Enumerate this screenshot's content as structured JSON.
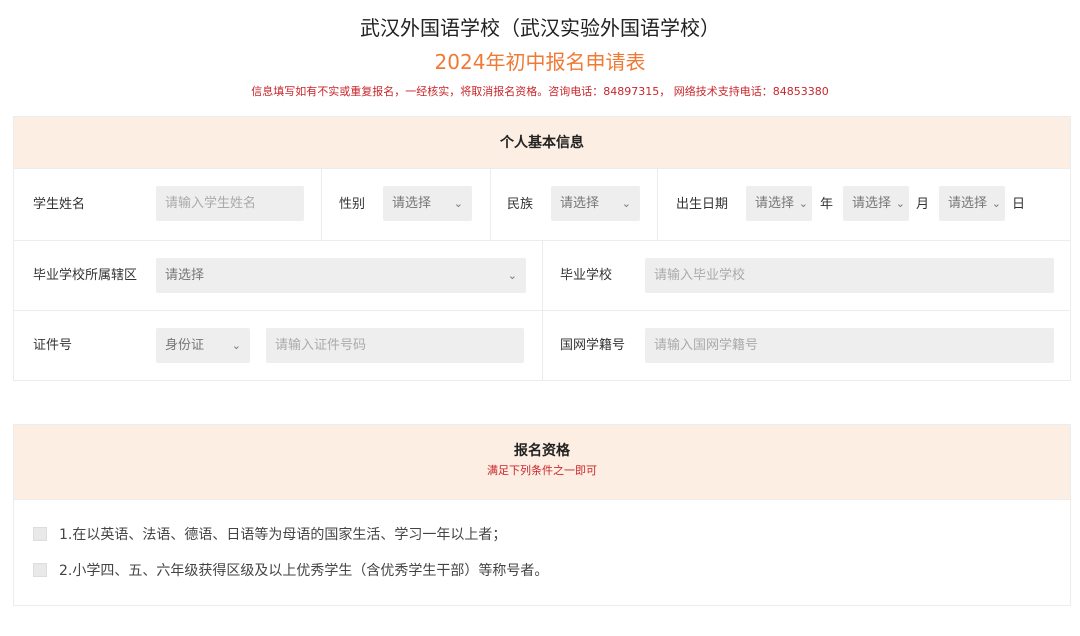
{
  "header": {
    "title": "武汉外国语学校（武汉实验外国语学校）",
    "subtitle": "2024年初中报名申请表",
    "notice": "信息填写如有不实或重复报名，一经核实，将取消报名资格。咨询电话：84897315， 网络技术支持电话：84853380"
  },
  "colors": {
    "accent": "#f07a35",
    "warning": "#c8262b",
    "header_bg": "#fdeee3",
    "field_bg": "#eeeeee"
  },
  "basic_info": {
    "heading": "个人基本信息",
    "student_name": {
      "label": "学生姓名",
      "placeholder": "请输入学生姓名"
    },
    "gender": {
      "label": "性别",
      "value": "请选择"
    },
    "ethnicity": {
      "label": "民族",
      "value": "请选择"
    },
    "birth_date": {
      "label": "出生日期",
      "year_value": "请选择",
      "year_unit": "年",
      "month_value": "请选择",
      "month_unit": "月",
      "day_value": "请选择",
      "day_unit": "日"
    },
    "district": {
      "label": "毕业学校所属辖区",
      "value": "请选择"
    },
    "school": {
      "label": "毕业学校",
      "placeholder": "请输入毕业学校"
    },
    "id_number": {
      "label": "证件号",
      "type_value": "身份证",
      "placeholder": "请输入证件号码"
    },
    "student_id": {
      "label": "国网学籍号",
      "placeholder": "请输入国网学籍号"
    }
  },
  "qualification": {
    "heading": "报名资格",
    "subheading": "满足下列条件之一即可",
    "options": [
      {
        "label": "1.在以英语、法语、德语、日语等为母语的国家生活、学习一年以上者；",
        "checked": false
      },
      {
        "label": "2.小学四、五、六年级获得区级及以上优秀学生（含优秀学生干部）等称号者。",
        "checked": false
      }
    ]
  }
}
